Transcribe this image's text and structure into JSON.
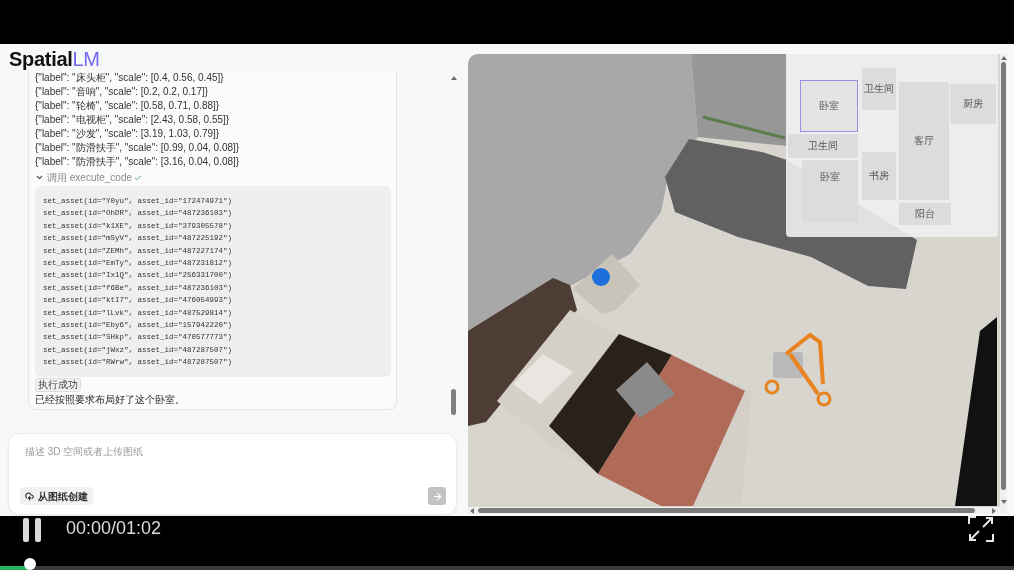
{
  "logo": {
    "main": "Spatial",
    "accent": "LM"
  },
  "chat": {
    "object_lines": [
      "{\"label\": \"床头柜\", \"scale\": [0.4, 0.56, 0.45]}",
      "{\"label\": \"音响\", \"scale\": [0.2, 0.2, 0.17]}",
      "{\"label\": \"轮椅\", \"scale\": [0.58, 0.71, 0.88]}",
      "{\"label\": \"电视柜\", \"scale\": [2.43, 0.58, 0.55]}",
      "{\"label\": \"沙发\", \"scale\": [3.19, 1.03, 0.79]}",
      "{\"label\": \"防滑扶手\", \"scale\": [0.99, 0.04, 0.08]}",
      "{\"label\": \"防滑扶手\", \"scale\": [3.16, 0.04, 0.08]}"
    ],
    "tool_call": {
      "label": "调用 execute_code",
      "expanded": true,
      "succeeded": true,
      "code_lines": [
        "set_asset(id=\"Y0yu\", asset_id=\"172474971\")",
        "set_asset(id=\"OhDR\", asset_id=\"487236103\")",
        "set_asset(id=\"k1XE\", asset_id=\"379305578\")",
        "set_asset(id=\"mSyV\", asset_id=\"487225192\")",
        "set_asset(id=\"ZEMh\", asset_id=\"487227174\")",
        "set_asset(id=\"EmTy\", asset_id=\"487231812\")",
        "set_asset(id=\"Ix1Q\", asset_id=\"256331700\")",
        "set_asset(id=\"f6Be\", asset_id=\"487236103\")",
        "set_asset(id=\"ktI7\", asset_id=\"476054993\")",
        "set_asset(id=\"lLvk\", asset_id=\"487529814\")",
        "set_asset(id=\"Eby6\", asset_id=\"157942220\")",
        "set_asset(id=\"SHkp\", asset_id=\"470577773\")",
        "set_asset(id=\"jWxz\", asset_id=\"487287507\")",
        "set_asset(id=\"RWrw\", asset_id=\"487287507\")"
      ]
    },
    "result_badge": "执行成功",
    "reply": "已经按照要求布局好了这个卧室。"
  },
  "composer": {
    "placeholder": "描述 3D 空间或者上传图纸",
    "upload_button": "从图纸创建",
    "send_disabled": true
  },
  "viewport": {
    "minimap": {
      "rooms": [
        {
          "label": "卫生间",
          "selected": false
        },
        {
          "label": "卧室",
          "selected": true
        },
        {
          "label": "厨房",
          "selected": false
        },
        {
          "label": "卫生间",
          "selected": false
        },
        {
          "label": "客厅",
          "selected": false
        },
        {
          "label": "卧室",
          "selected": false
        },
        {
          "label": "书房",
          "selected": false
        },
        {
          "label": "阳台",
          "selected": false
        }
      ]
    }
  },
  "video_player": {
    "playing": true,
    "time": "00:00/01:02",
    "progress": {
      "level": 0.03
    }
  }
}
